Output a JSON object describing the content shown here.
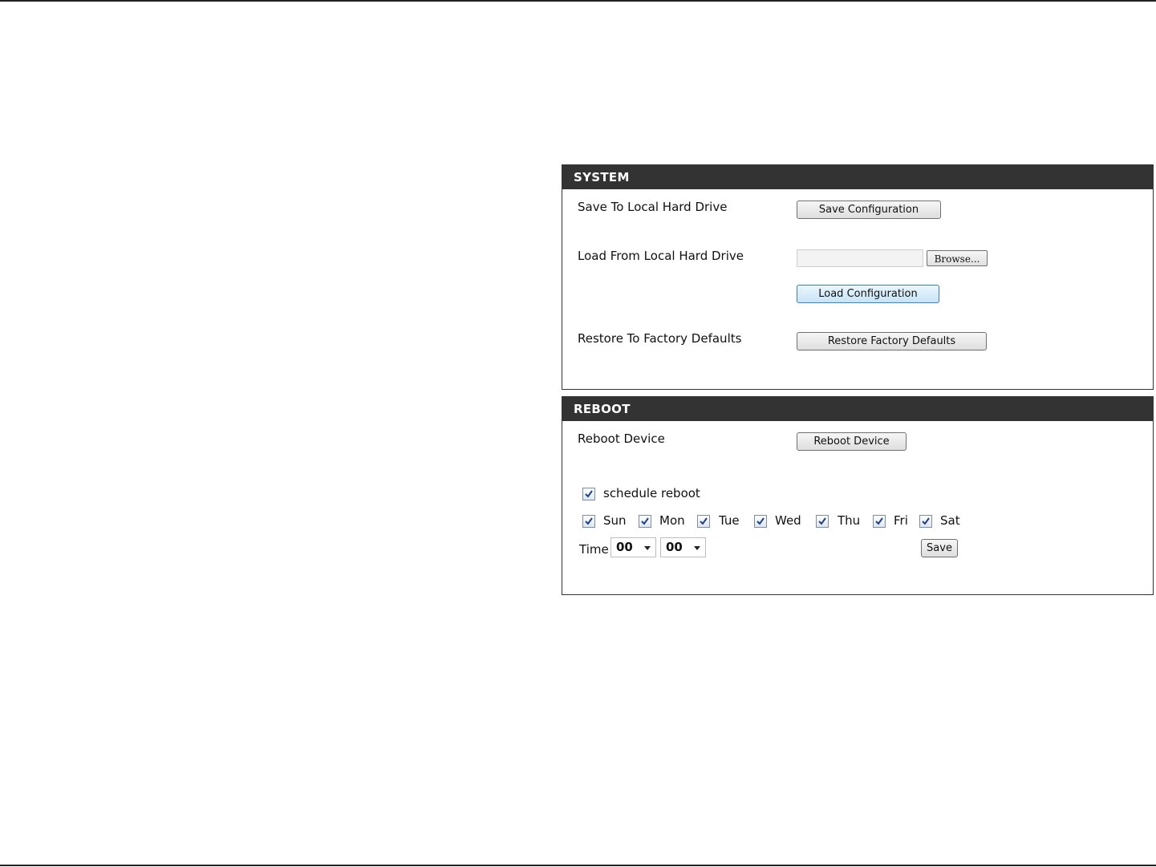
{
  "system": {
    "header": "SYSTEM",
    "save_label": "Save To Local Hard Drive",
    "save_button": "Save Configuration",
    "load_label": "Load From Local Hard Drive",
    "file_value": "",
    "browse_button": "Browse...",
    "load_button": "Load Configuration",
    "restore_label": "Restore To Factory Defaults",
    "restore_button": "Restore Factory Defaults"
  },
  "reboot": {
    "header": "REBOOT",
    "reboot_label": "Reboot Device",
    "reboot_button": "Reboot Device",
    "schedule_label": "schedule reboot",
    "schedule_checked": true,
    "days": [
      {
        "label": "Sun",
        "checked": true
      },
      {
        "label": "Mon",
        "checked": true
      },
      {
        "label": "Tue",
        "checked": true
      },
      {
        "label": "Wed",
        "checked": true
      },
      {
        "label": "Thu",
        "checked": true
      },
      {
        "label": "Fri",
        "checked": true
      },
      {
        "label": "Sat",
        "checked": true
      }
    ],
    "time_label": "Time",
    "hour": "00",
    "minute": "00",
    "save_button": "Save"
  },
  "colors": {
    "header_bg": "#333333",
    "header_text": "#ffffff",
    "checkmark": "#1e3f8a"
  }
}
